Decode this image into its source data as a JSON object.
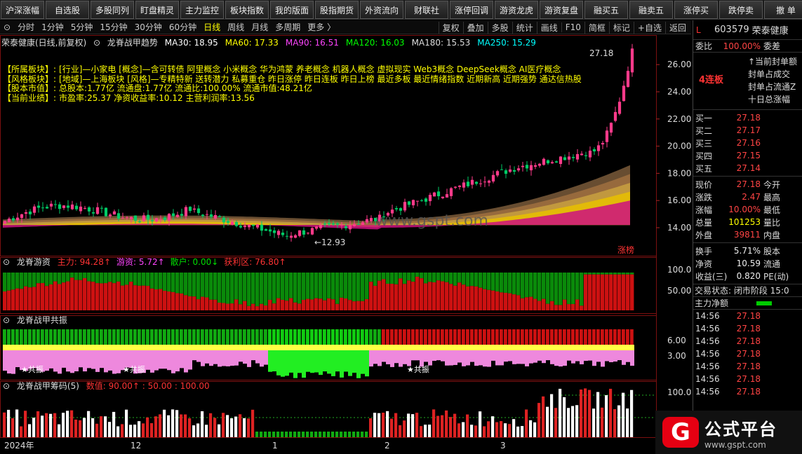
{
  "toolbar": {
    "buttons": [
      "沪深涨幅",
      "自选股",
      "多股同列",
      "盯盘精灵",
      "主力监控",
      "板块指数",
      "我的版面",
      "股指期货",
      "外资流向",
      "财联社",
      "涨停回调",
      "游资龙虎",
      "游资复盘",
      "融买五",
      "融卖五",
      "涨停买",
      "跌停卖",
      "撤 单"
    ]
  },
  "periodbar": {
    "items": [
      "分时",
      "1分钟",
      "5分钟",
      "15分钟",
      "30分钟",
      "60分钟",
      "日线",
      "周线",
      "月线",
      "多周期",
      "更多 〉"
    ],
    "active": "日线",
    "right_items": [
      "复权",
      "叠加",
      "多股",
      "统计",
      "画线",
      "F10",
      "简框",
      "标记",
      "+自选",
      "返回"
    ]
  },
  "main_chart": {
    "stock_title": "荣泰健康(日线,前复权)",
    "indicator_name": "龙脊战甲趋势",
    "ma": [
      {
        "label": "MA30: 18.95",
        "color": "#ffffff"
      },
      {
        "label": "MA60: 17.33",
        "color": "#ffff00"
      },
      {
        "label": "MA90: 16.51",
        "color": "#ff44ff"
      },
      {
        "label": "MA120: 16.03",
        "color": "#00ff00"
      },
      {
        "label": "MA180: 15.53",
        "color": "#dddddd"
      },
      {
        "label": "MA250: 15.29",
        "color": "#00ffff"
      }
    ],
    "info_lines": [
      {
        "label": "【所属板块】:",
        "text": "[行业]—小家电 [概念]—含可转债 阿里概念 小米概念 华为鸿蒙 养老概念 机器人概念 虚拟现实 Web3概念 DeepSeek概念 AI医疗概念"
      },
      {
        "label": "【风格板块】:",
        "text": "[地域]—上海板块 [风格]—专精特新 送转潜力 私募重仓 昨日涨停 昨日连板 昨日上榜 最近多板 最近情绪指数 近期新高 近期强势 通达信热股"
      },
      {
        "label": "【股本市值】:",
        "text": "总股本:1.77亿 流通盘:1.77亿 流通比:100.00% 流通市值:48.21亿"
      },
      {
        "label": "【当前业绩】:",
        "text": "市盈率:25.37 净资收益率:10.12 主营利润率:13.56"
      }
    ],
    "high_label": "27.18",
    "low_label": "←12.93",
    "watermark": "www.gspt.com",
    "zhangbang": "涨榜",
    "y_ticks": [
      "26.00",
      "24.00",
      "22.00",
      "20.00",
      "18.00",
      "16.00",
      "14.00"
    ]
  },
  "panel1": {
    "name": "龙脊游资",
    "values": [
      {
        "label": "主力: 94.28↑",
        "color": "#ff3333"
      },
      {
        "label": "游资: 5.72↑",
        "color": "#ff44ff"
      },
      {
        "label": "散户: 0.00↓",
        "color": "#00dd00"
      },
      {
        "label": "获利区: 76.80↑",
        "color": "#ff3333"
      }
    ],
    "y_ticks": [
      "100.0",
      "50.00"
    ]
  },
  "panel2": {
    "name": "龙脊战甲共振",
    "gongzhen_label": "★共振",
    "y_ticks": [
      "6.00",
      "3.00"
    ]
  },
  "panel3": {
    "name": "龙脊战甲筹码(5)",
    "values_text": "数值: 90.00↑ : 50.00 : 100.00",
    "y_ticks": [
      "100.0"
    ]
  },
  "x_axis": {
    "labels": [
      "2024年",
      "12",
      "1",
      "2",
      "3"
    ]
  },
  "right_panel": {
    "flag": "L",
    "code": "603579",
    "name": "荣泰健康",
    "weibi_label": "委比",
    "weibi_value": "100.00%",
    "weicha_label": "委差",
    "lianban": "4连板",
    "seal_items": [
      "↑当前封单额",
      "封单占成交",
      "封单占流通Z",
      "十日总涨幅"
    ],
    "bids": [
      {
        "label": "买一",
        "price": "27.18"
      },
      {
        "label": "买二",
        "price": "27.17"
      },
      {
        "label": "买三",
        "price": "27.16"
      },
      {
        "label": "买四",
        "price": "27.15"
      },
      {
        "label": "买五",
        "price": "27.14"
      }
    ],
    "quote": [
      {
        "l": "现价",
        "v": "27.18",
        "r": "今开"
      },
      {
        "l": "涨跌",
        "v": "2.47",
        "r": "最高"
      },
      {
        "l": "涨幅",
        "v": "10.00%",
        "r": "最低"
      },
      {
        "l": "总量",
        "v": "101253",
        "r": "量比"
      },
      {
        "l": "外盘",
        "v": "39811",
        "r": "内盘"
      }
    ],
    "stats": [
      {
        "l": "换手",
        "v": "5.71%",
        "r": "股本"
      },
      {
        "l": "净资",
        "v": "10.59",
        "r": "流通"
      },
      {
        "l": "收益(三)",
        "v": "0.820",
        "r": "PE(动)"
      }
    ],
    "trade_status": "交易状态: 闭市阶段 15:0",
    "net_label": "主力净额",
    "ticks": [
      {
        "t": "14:56",
        "p": "27.18"
      },
      {
        "t": "14:56",
        "p": "27.18"
      },
      {
        "t": "14:56",
        "p": "27.18"
      },
      {
        "t": "14:56",
        "p": "27.18"
      },
      {
        "t": "14:56",
        "p": "27.18"
      },
      {
        "t": "14:56",
        "p": "27.18"
      },
      {
        "t": "14:56",
        "p": "27.18"
      }
    ]
  },
  "logo": {
    "title": "公式平台",
    "url": "www.gspt.com"
  }
}
